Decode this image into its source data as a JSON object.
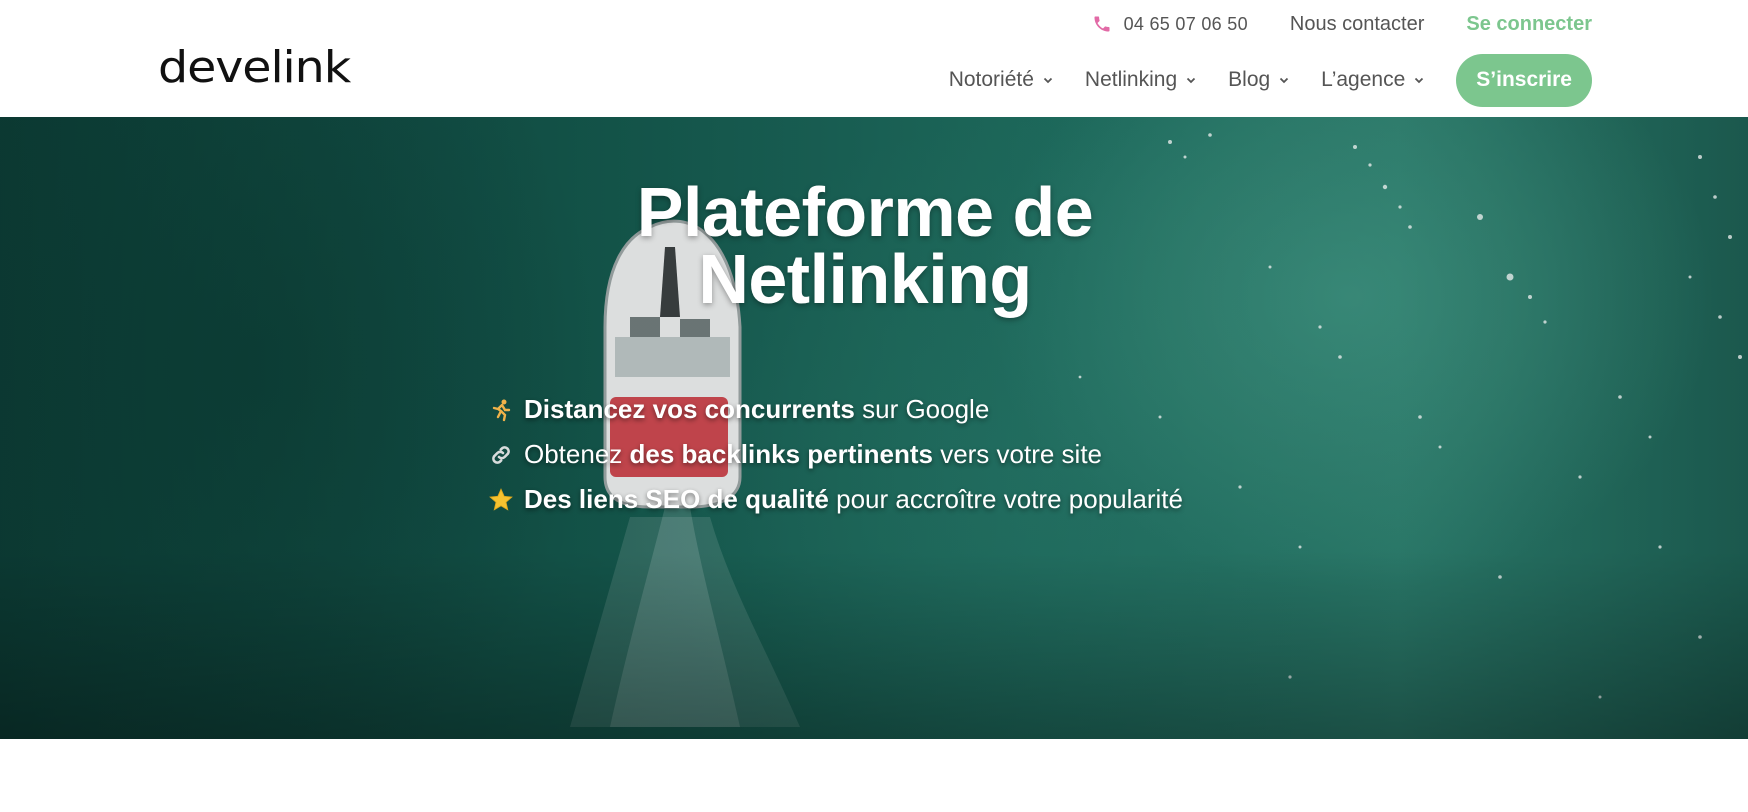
{
  "header": {
    "logo_text": "develink",
    "phone": "04 65 07 06 50",
    "contact_label": "Nous contacter",
    "login_label": "Se connecter",
    "nav": [
      {
        "label": "Notoriété"
      },
      {
        "label": "Netlinking"
      },
      {
        "label": "Blog"
      },
      {
        "label": "L’agence"
      }
    ],
    "signup_label": "S’inscrire"
  },
  "hero": {
    "title_line1": "Plateforme de",
    "title_line2": "Netlinking",
    "bullets": [
      {
        "icon": "runner-icon",
        "bold": "Distancez vos concurrents",
        "rest": " sur Google"
      },
      {
        "icon": "link-icon",
        "pre": "Obtenez ",
        "bold": "des backlinks pertinents",
        "rest": " vers votre site"
      },
      {
        "icon": "star-icon",
        "bold": "Des liens SEO de qualité",
        "rest": " pour accroître votre popularité"
      }
    ]
  },
  "colors": {
    "accent": "#7cc68e",
    "phone_icon": "#e26aa6",
    "text_gray": "#555555"
  }
}
